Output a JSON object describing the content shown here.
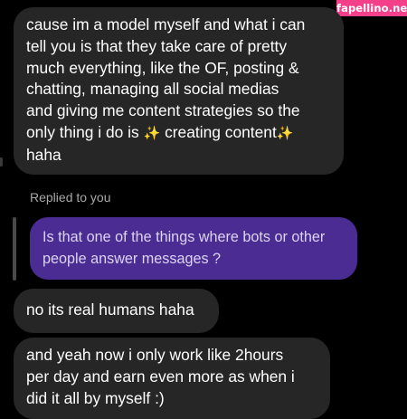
{
  "watermark": "fapellino.net",
  "messages": {
    "first": {
      "line1": "cause im a model myself and what i can",
      "line2": "tell you is that they take care of pretty",
      "line3": "much everything, like the OF, posting &",
      "line4": "chatting, managing all social medias",
      "line5": "and giving me content strategies so the",
      "line6_before": "only thing i do is ",
      "line6_sparkle1": "✨",
      "line6_middle": " creating content",
      "line6_sparkle2": "✨",
      "line7": "haha"
    },
    "replied_label": "Replied to you",
    "reply": {
      "line1": "Is that one of the things where bots or other",
      "line2": "people answer messages ?"
    },
    "second": "no its real humans haha",
    "third": {
      "line1": "and yeah now i only work like 2hours",
      "line2": "per day and earn even more as when i",
      "line3": "did it all by myself :)"
    }
  },
  "colors": {
    "background": "#000000",
    "incoming_bubble": "#262626",
    "reply_bubble": "#4a2c92",
    "watermark_bg": "#f43f8a",
    "sparkle": "#f5c518"
  }
}
